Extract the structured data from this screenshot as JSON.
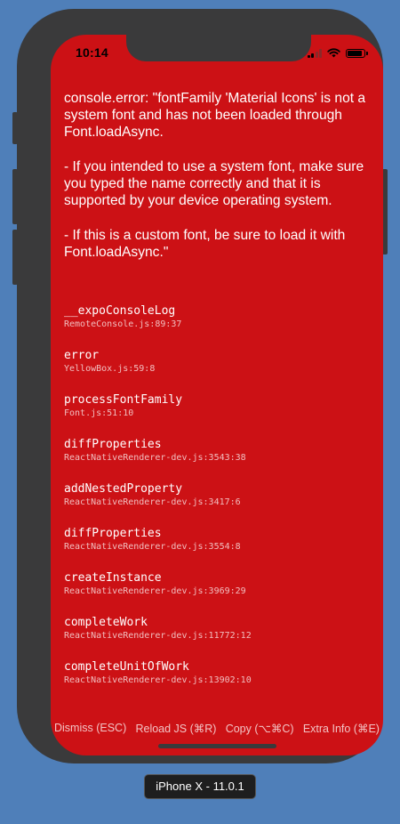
{
  "status_bar": {
    "time": "10:14"
  },
  "error": {
    "message": "console.error: \"fontFamily 'Material Icons' is not a system font and has not been loaded through Font.loadAsync.\n\n- If you intended to use a system font, make sure you typed the name correctly and that it is supported by your device operating system.\n\n- If this is a custom font, be sure to load it with Font.loadAsync.\""
  },
  "stack": [
    {
      "method": "__expoConsoleLog",
      "location": "RemoteConsole.js:89:37"
    },
    {
      "method": "error",
      "location": "YellowBox.js:59:8"
    },
    {
      "method": "processFontFamily",
      "location": "Font.js:51:10"
    },
    {
      "method": "diffProperties",
      "location": "ReactNativeRenderer-dev.js:3543:38"
    },
    {
      "method": "addNestedProperty",
      "location": "ReactNativeRenderer-dev.js:3417:6"
    },
    {
      "method": "diffProperties",
      "location": "ReactNativeRenderer-dev.js:3554:8"
    },
    {
      "method": "createInstance",
      "location": "ReactNativeRenderer-dev.js:3969:29"
    },
    {
      "method": "completeWork",
      "location": "ReactNativeRenderer-dev.js:11772:12"
    },
    {
      "method": "completeUnitOfWork",
      "location": "ReactNativeRenderer-dev.js:13902:10"
    }
  ],
  "toolbar": {
    "dismiss": "Dismiss (ESC)",
    "reload": "Reload JS (⌘R)",
    "copy": "Copy (⌥⌘C)",
    "extra": "Extra Info (⌘E)"
  },
  "device_label": "iPhone X - 11.0.1",
  "colors": {
    "background": "#4f7fb9",
    "device_frame": "#3a3a3b",
    "error_red": "#cc1115"
  }
}
